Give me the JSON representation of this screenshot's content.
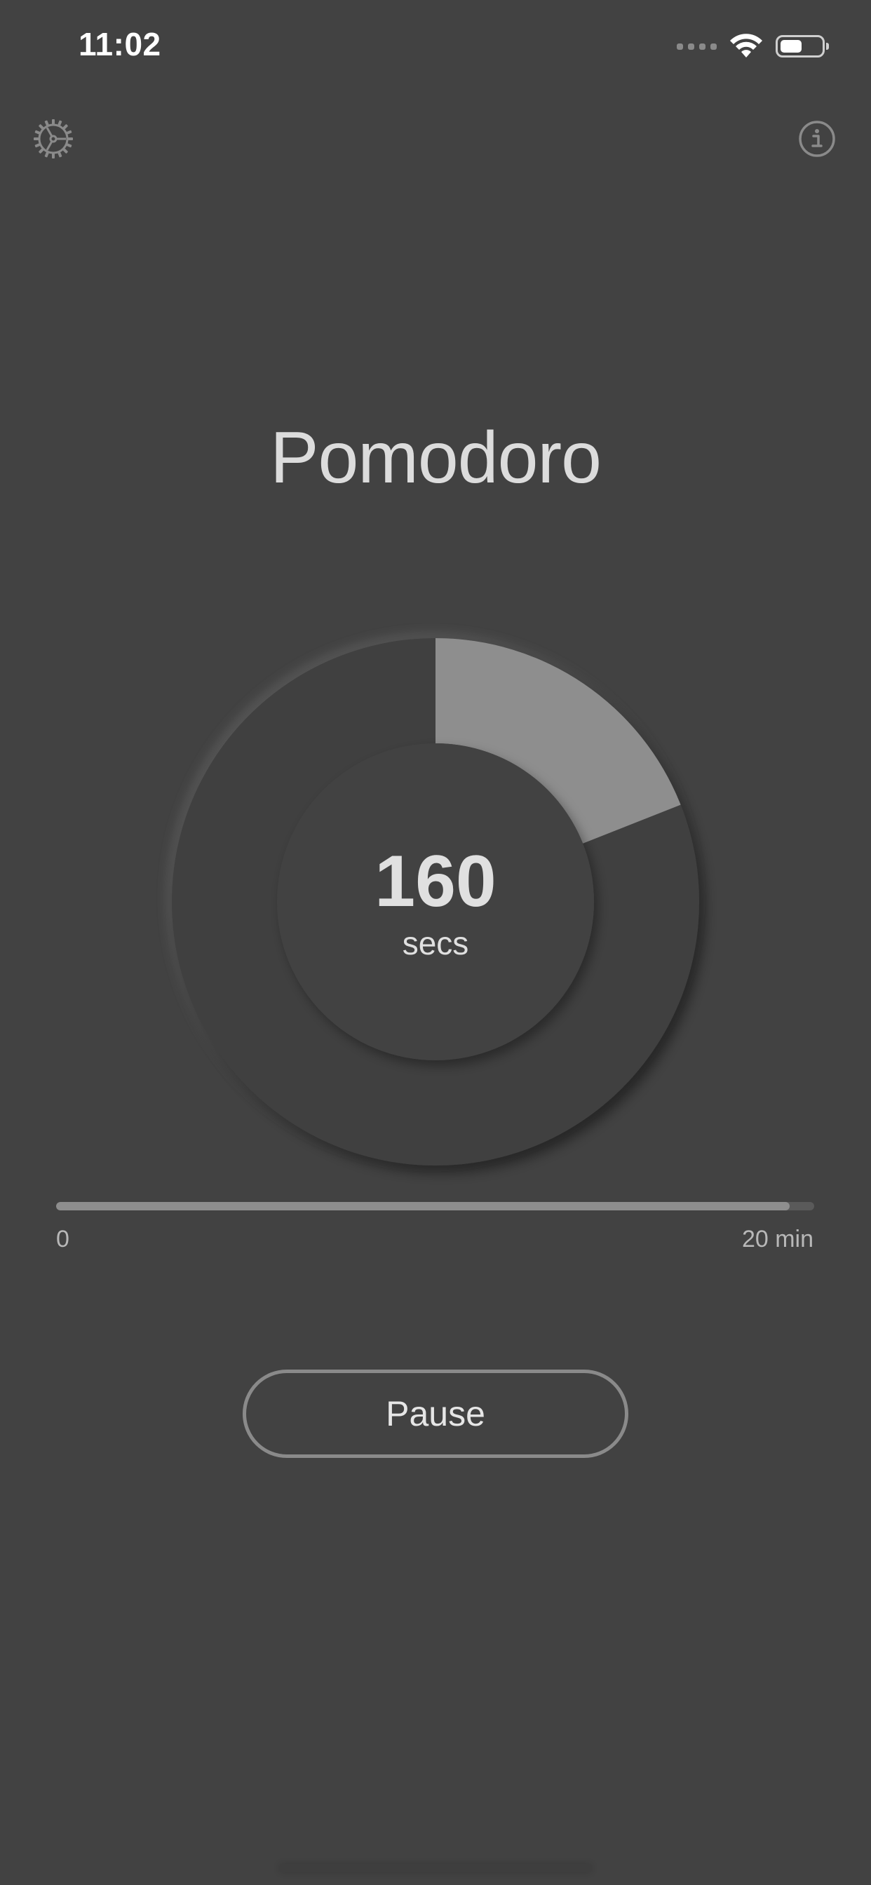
{
  "status_bar": {
    "time": "11:02"
  },
  "header": {
    "settings_icon": "gear-icon",
    "info_icon": "info-icon"
  },
  "timer": {
    "title": "Pomodoro",
    "value": "160",
    "unit": "secs",
    "ring_fraction": 0.19
  },
  "progress": {
    "fraction": 0.968,
    "min_label": "0",
    "max_label": "20 min"
  },
  "controls": {
    "pause_label": "Pause"
  },
  "colors": {
    "background": "#424242",
    "ring_fill": "#8e8e8e",
    "text": "#dcdcdc",
    "muted": "#b8b8b8"
  }
}
